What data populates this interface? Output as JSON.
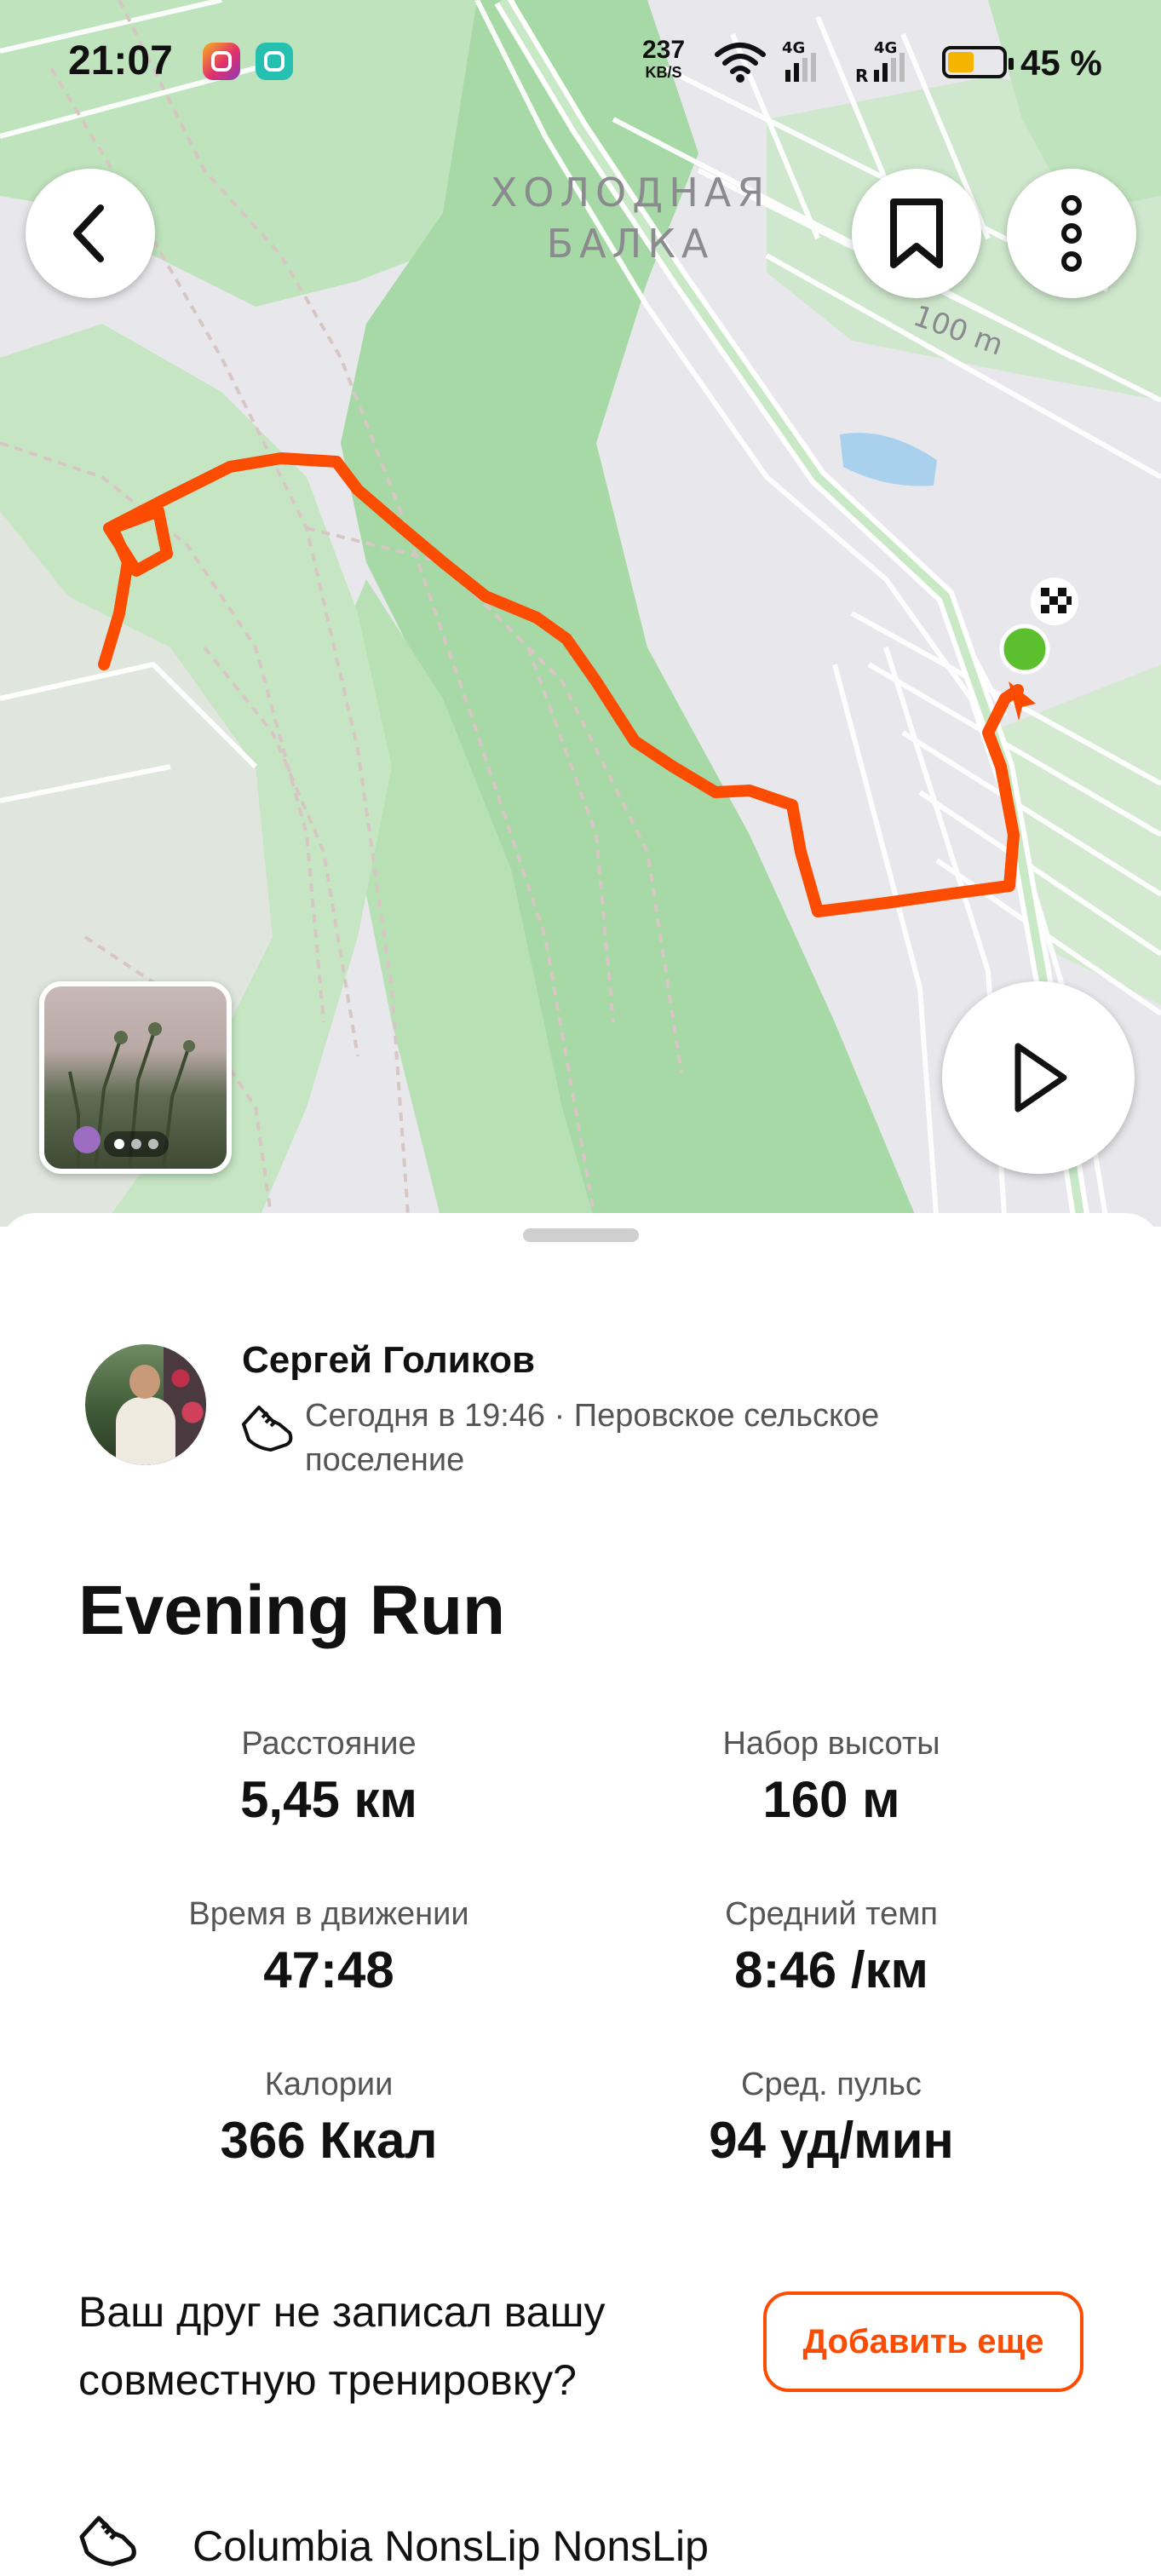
{
  "status_bar": {
    "time": "21:07",
    "net_speed_value": "237",
    "net_speed_unit": "KB/S",
    "battery_percent": "45 %",
    "icons": [
      "instagram-icon",
      "messenger-icon",
      "wifi-icon",
      "signal-4g-icon",
      "signal-4g-roaming-icon",
      "battery-icon"
    ]
  },
  "map": {
    "place_label_line1": "ХОЛОДНАЯ",
    "place_label_line2": "БАЛКА",
    "contour_label": "100 m",
    "route_color": "#fc4c02",
    "start_marker_color": "#5cc02e",
    "photo_count": 3
  },
  "buttons": {
    "back": "back-icon",
    "bookmark": "bookmark-icon",
    "more": "more-vertical-icon",
    "play": "play-icon"
  },
  "activity": {
    "athlete_name": "Сергей Голиков",
    "meta": "Сегодня в 19:46 · Перовское сельское поселение",
    "title": "Evening Run",
    "stats": [
      {
        "label": "Расстояние",
        "value": "5,45 км"
      },
      {
        "label": "Набор высоты",
        "value": "160 м"
      },
      {
        "label": "Время в движении",
        "value": "47:48"
      },
      {
        "label": "Средний темп",
        "value": "8:46 /км"
      },
      {
        "label": "Калории",
        "value": "366 Ккал"
      },
      {
        "label": "Сред. пульс",
        "value": "94 уд/мин"
      }
    ]
  },
  "friend_prompt": {
    "text": "Ваш друг не записал вашу совместную тренировку?",
    "button_label": "Добавить еще"
  },
  "gear": {
    "text": "Columbia NonsLip NonsLip"
  },
  "colors": {
    "accent": "#fc4c02",
    "map_green": "#a6d9a5",
    "map_bg": "#e8e8ec"
  }
}
